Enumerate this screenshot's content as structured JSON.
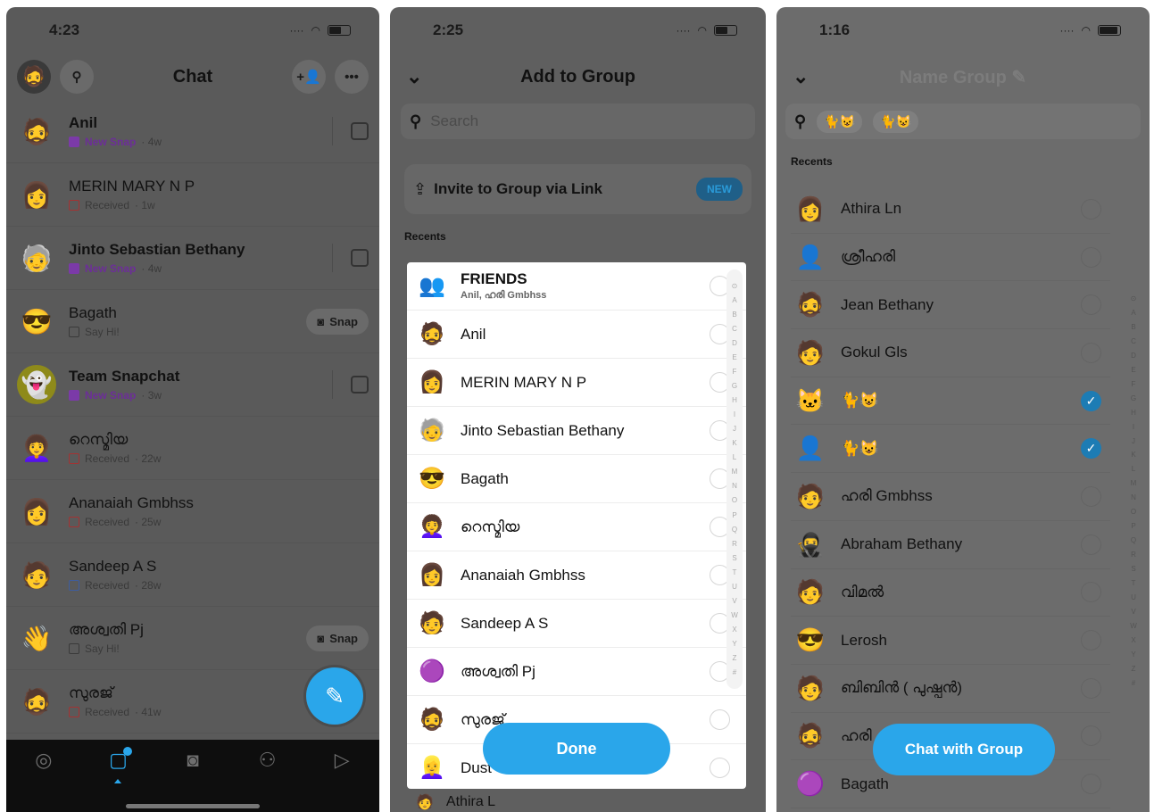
{
  "panel1": {
    "status_time": "4:23",
    "header_title": "Chat",
    "add_friend_label": "+👤",
    "more_label": "•••",
    "chats": [
      {
        "name": "Anil",
        "status": "New Snap",
        "time": "· 4w",
        "kind": "new",
        "action": "chat"
      },
      {
        "name": "MERIN MARY  N P",
        "status": "Received",
        "time": "· 1w",
        "kind": "received-red",
        "action": "none"
      },
      {
        "name": "Jinto Sebastian Bethany",
        "status": "New Snap",
        "time": "· 4w",
        "kind": "new",
        "action": "chat"
      },
      {
        "name": "Bagath",
        "status": "Say Hi!",
        "time": "",
        "kind": "sayhi",
        "action": "snap"
      },
      {
        "name": "Team Snapchat",
        "status": "New Snap",
        "time": "· 3w",
        "kind": "new",
        "action": "chat"
      },
      {
        "name": "റെസ്മിയ",
        "status": "Received",
        "time": "· 22w",
        "kind": "received-red",
        "action": "none"
      },
      {
        "name": "Ananaiah Gmbhss",
        "status": "Received",
        "time": "· 25w",
        "kind": "received-red",
        "action": "none"
      },
      {
        "name": "Sandeep A S",
        "status": "Received",
        "time": "· 28w",
        "kind": "received-blue",
        "action": "none"
      },
      {
        "name": "അശ്വതി Pj",
        "status": "Say Hi!",
        "time": "",
        "kind": "sayhi",
        "action": "snap"
      },
      {
        "name": "സുരജ്",
        "status": "Received",
        "time": "· 41w",
        "kind": "received-red",
        "action": "none"
      }
    ],
    "snap_label": "Snap",
    "tabs": [
      "map",
      "chat",
      "camera",
      "friends",
      "stories"
    ]
  },
  "panel2": {
    "status_time": "2:25",
    "header_title": "Add to Group",
    "search_placeholder": "Search",
    "invite_label": "Invite to Group via Link",
    "new_badge": "NEW",
    "section_label": "Recents",
    "rows": [
      {
        "name": "FRIENDS",
        "sub": "Anil, ഹരി Gmbhss"
      },
      {
        "name": "Anil",
        "sub": ""
      },
      {
        "name": "MERIN MARY  N P",
        "sub": ""
      },
      {
        "name": "Jinto Sebastian Bethany",
        "sub": ""
      },
      {
        "name": "Bagath",
        "sub": ""
      },
      {
        "name": "റെസ്മിയ",
        "sub": ""
      },
      {
        "name": "Ananaiah Gmbhss",
        "sub": ""
      },
      {
        "name": "Sandeep A S",
        "sub": ""
      },
      {
        "name": "അശ്വതി Pj",
        "sub": ""
      },
      {
        "name": "സുരജ്",
        "sub": ""
      },
      {
        "name": "Dust",
        "sub": ""
      }
    ],
    "done_label": "Done",
    "bottom_peek": "Athira L"
  },
  "panel3": {
    "status_time": "1:16",
    "header_title": "Name Group",
    "chip_1": "🐈😺",
    "chip_2": "🐈😺",
    "section_label": "Recents",
    "rows": [
      {
        "name": "Athira Ln",
        "checked": false
      },
      {
        "name": "ശ്രീഹരി",
        "checked": false
      },
      {
        "name": "Jean Bethany",
        "checked": false
      },
      {
        "name": "Gokul Gls",
        "checked": false
      },
      {
        "name": "🐈😺",
        "checked": true
      },
      {
        "name": "🐈😺",
        "checked": true
      },
      {
        "name": "ഹരി Gmbhss",
        "checked": false
      },
      {
        "name": "Abraham Bethany",
        "checked": false
      },
      {
        "name": "വിമൽ",
        "checked": false
      },
      {
        "name": "Lerosh",
        "checked": false
      },
      {
        "name": "ബിബിൻ ( പുഷ്പൻ)",
        "checked": false
      },
      {
        "name": "ഹരി",
        "checked": false
      },
      {
        "name": "Bagath",
        "checked": false
      }
    ],
    "cta_label": "Chat with Group"
  },
  "alphabet": [
    "⊙",
    "A",
    "B",
    "C",
    "D",
    "E",
    "F",
    "G",
    "H",
    "I",
    "J",
    "K",
    "L",
    "M",
    "N",
    "O",
    "P",
    "Q",
    "R",
    "S",
    "T",
    "U",
    "V",
    "W",
    "X",
    "Y",
    "Z",
    "#"
  ],
  "colors": {
    "accent": "#2aa6ea",
    "new_snap": "#7b3aa8"
  }
}
